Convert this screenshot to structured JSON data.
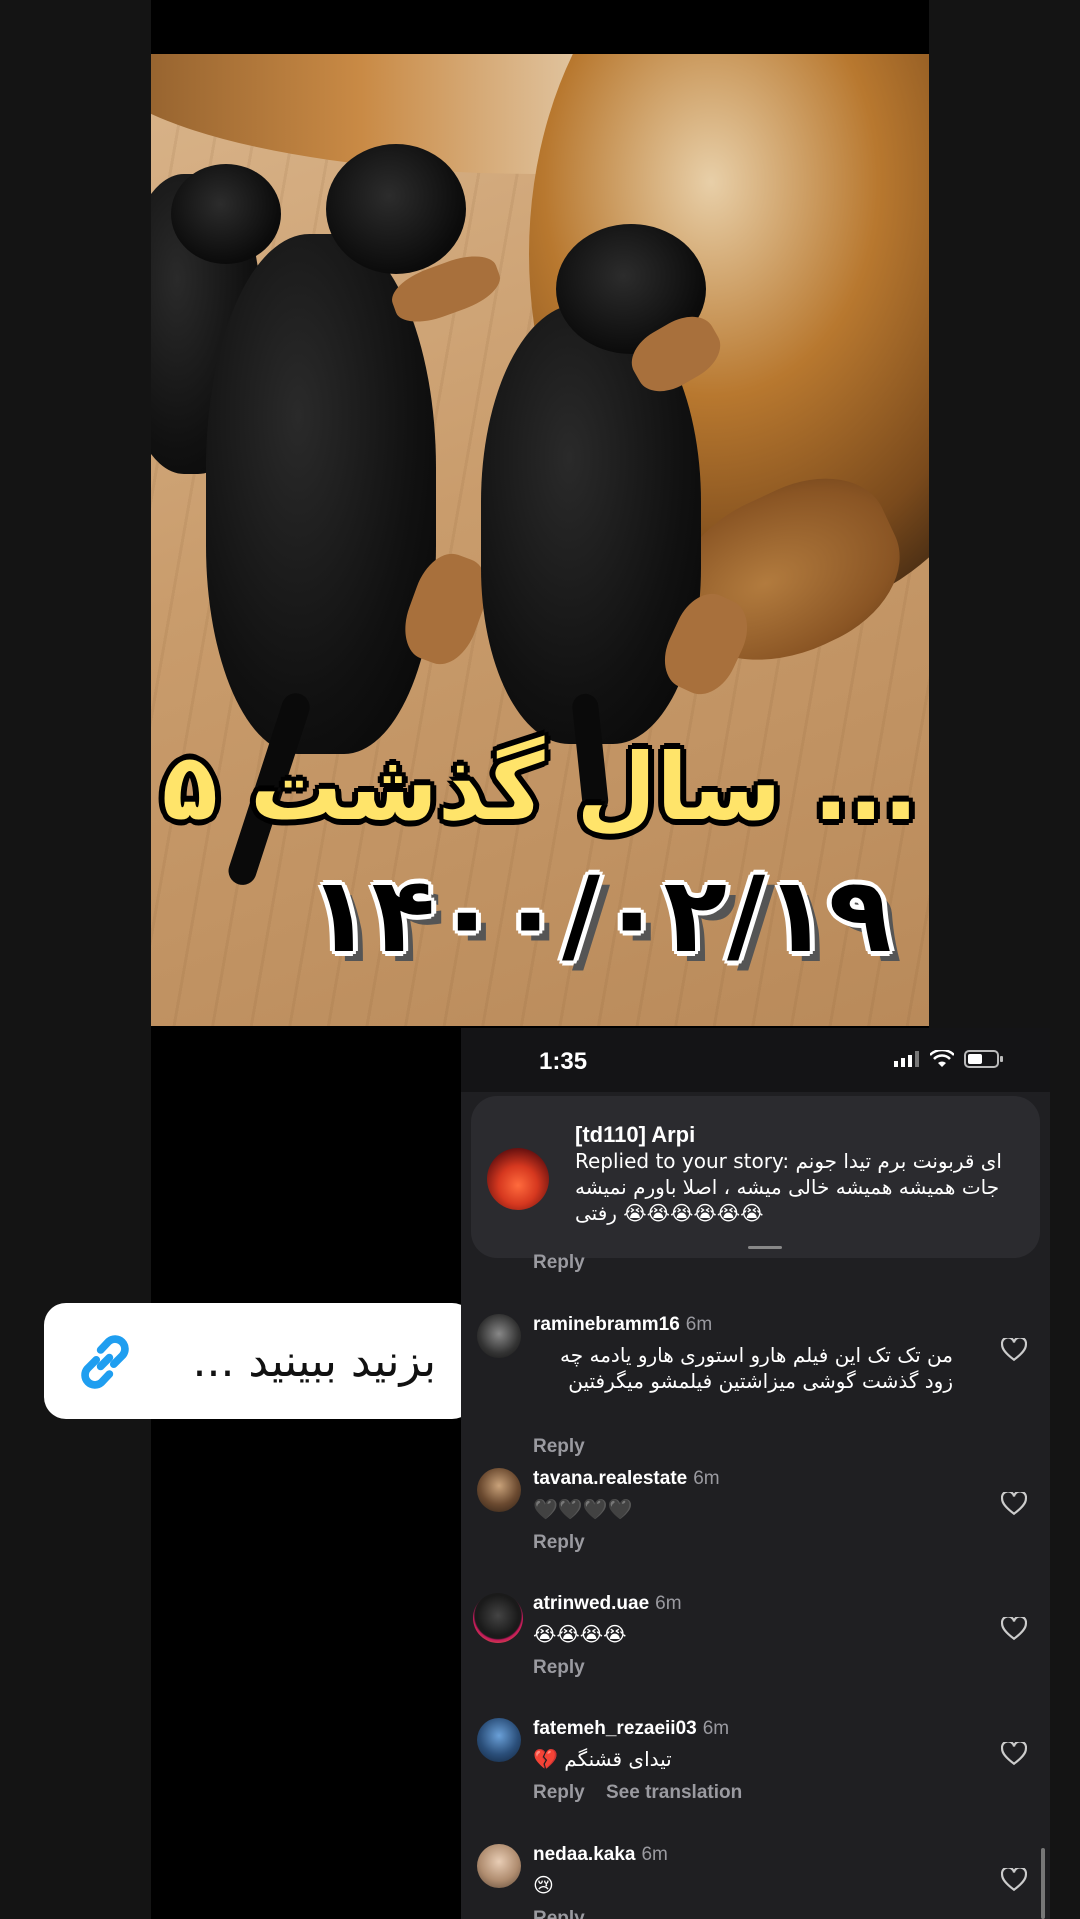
{
  "story": {
    "overlay_line1": "۵ سال گذشت ...",
    "overlay_line2": "۱۴۰۰/۰۲/۱۹"
  },
  "link_sticker": {
    "text": "بزنید ببینید ..."
  },
  "phone": {
    "status_time": "1:35",
    "notification": {
      "title": "[td110] Arpi",
      "body": "Replied to your story: ای قربونت برم تیدا جونم جات همیشه همیشه خالی میشه ، اصلا باورم نمیشه رفتی 😭😭😭😭😭😭"
    },
    "reply_label": "Reply",
    "see_translation_label": "See translation",
    "comments": [
      {
        "user": "raminebramm16",
        "time": "6m",
        "text": "من تک تک این فیلم هارو استوری هارو یادمه چه زود گذشت گوشی میزاشتین فیلمشو میگرفتین"
      },
      {
        "user": "tavana.realestate",
        "time": "6m",
        "text": "🖤🖤🖤🖤"
      },
      {
        "user": "atrinwed.uae",
        "time": "6m",
        "text": "😭😭😭😭"
      },
      {
        "user": "fatemeh_rezaeii03",
        "time": "6m",
        "text": "تیدای قشنگم 💔"
      },
      {
        "user": "nedaa.kaka",
        "time": "6m",
        "text": "😢"
      }
    ]
  }
}
